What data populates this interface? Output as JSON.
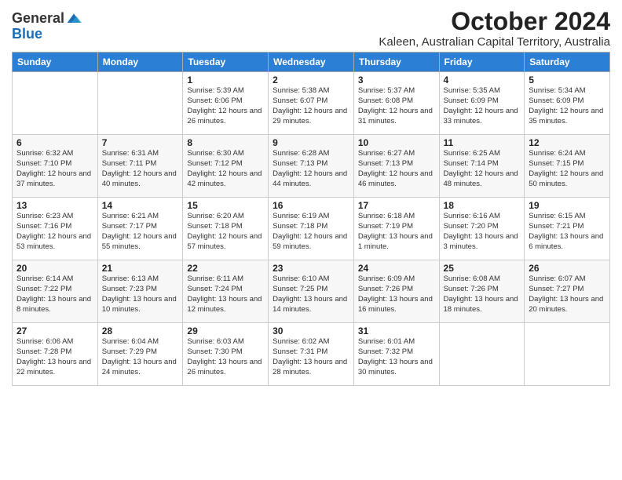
{
  "logo": {
    "general": "General",
    "blue": "Blue"
  },
  "title": "October 2024",
  "subtitle": "Kaleen, Australian Capital Territory, Australia",
  "days_of_week": [
    "Sunday",
    "Monday",
    "Tuesday",
    "Wednesday",
    "Thursday",
    "Friday",
    "Saturday"
  ],
  "weeks": [
    [
      {
        "day": "",
        "detail": ""
      },
      {
        "day": "",
        "detail": ""
      },
      {
        "day": "1",
        "detail": "Sunrise: 5:39 AM\nSunset: 6:06 PM\nDaylight: 12 hours\nand 26 minutes."
      },
      {
        "day": "2",
        "detail": "Sunrise: 5:38 AM\nSunset: 6:07 PM\nDaylight: 12 hours\nand 29 minutes."
      },
      {
        "day": "3",
        "detail": "Sunrise: 5:37 AM\nSunset: 6:08 PM\nDaylight: 12 hours\nand 31 minutes."
      },
      {
        "day": "4",
        "detail": "Sunrise: 5:35 AM\nSunset: 6:09 PM\nDaylight: 12 hours\nand 33 minutes."
      },
      {
        "day": "5",
        "detail": "Sunrise: 5:34 AM\nSunset: 6:09 PM\nDaylight: 12 hours\nand 35 minutes."
      }
    ],
    [
      {
        "day": "6",
        "detail": "Sunrise: 6:32 AM\nSunset: 7:10 PM\nDaylight: 12 hours\nand 37 minutes."
      },
      {
        "day": "7",
        "detail": "Sunrise: 6:31 AM\nSunset: 7:11 PM\nDaylight: 12 hours\nand 40 minutes."
      },
      {
        "day": "8",
        "detail": "Sunrise: 6:30 AM\nSunset: 7:12 PM\nDaylight: 12 hours\nand 42 minutes."
      },
      {
        "day": "9",
        "detail": "Sunrise: 6:28 AM\nSunset: 7:13 PM\nDaylight: 12 hours\nand 44 minutes."
      },
      {
        "day": "10",
        "detail": "Sunrise: 6:27 AM\nSunset: 7:13 PM\nDaylight: 12 hours\nand 46 minutes."
      },
      {
        "day": "11",
        "detail": "Sunrise: 6:25 AM\nSunset: 7:14 PM\nDaylight: 12 hours\nand 48 minutes."
      },
      {
        "day": "12",
        "detail": "Sunrise: 6:24 AM\nSunset: 7:15 PM\nDaylight: 12 hours\nand 50 minutes."
      }
    ],
    [
      {
        "day": "13",
        "detail": "Sunrise: 6:23 AM\nSunset: 7:16 PM\nDaylight: 12 hours\nand 53 minutes."
      },
      {
        "day": "14",
        "detail": "Sunrise: 6:21 AM\nSunset: 7:17 PM\nDaylight: 12 hours\nand 55 minutes."
      },
      {
        "day": "15",
        "detail": "Sunrise: 6:20 AM\nSunset: 7:18 PM\nDaylight: 12 hours\nand 57 minutes."
      },
      {
        "day": "16",
        "detail": "Sunrise: 6:19 AM\nSunset: 7:18 PM\nDaylight: 12 hours\nand 59 minutes."
      },
      {
        "day": "17",
        "detail": "Sunrise: 6:18 AM\nSunset: 7:19 PM\nDaylight: 13 hours\nand 1 minute."
      },
      {
        "day": "18",
        "detail": "Sunrise: 6:16 AM\nSunset: 7:20 PM\nDaylight: 13 hours\nand 3 minutes."
      },
      {
        "day": "19",
        "detail": "Sunrise: 6:15 AM\nSunset: 7:21 PM\nDaylight: 13 hours\nand 6 minutes."
      }
    ],
    [
      {
        "day": "20",
        "detail": "Sunrise: 6:14 AM\nSunset: 7:22 PM\nDaylight: 13 hours\nand 8 minutes."
      },
      {
        "day": "21",
        "detail": "Sunrise: 6:13 AM\nSunset: 7:23 PM\nDaylight: 13 hours\nand 10 minutes."
      },
      {
        "day": "22",
        "detail": "Sunrise: 6:11 AM\nSunset: 7:24 PM\nDaylight: 13 hours\nand 12 minutes."
      },
      {
        "day": "23",
        "detail": "Sunrise: 6:10 AM\nSunset: 7:25 PM\nDaylight: 13 hours\nand 14 minutes."
      },
      {
        "day": "24",
        "detail": "Sunrise: 6:09 AM\nSunset: 7:26 PM\nDaylight: 13 hours\nand 16 minutes."
      },
      {
        "day": "25",
        "detail": "Sunrise: 6:08 AM\nSunset: 7:26 PM\nDaylight: 13 hours\nand 18 minutes."
      },
      {
        "day": "26",
        "detail": "Sunrise: 6:07 AM\nSunset: 7:27 PM\nDaylight: 13 hours\nand 20 minutes."
      }
    ],
    [
      {
        "day": "27",
        "detail": "Sunrise: 6:06 AM\nSunset: 7:28 PM\nDaylight: 13 hours\nand 22 minutes."
      },
      {
        "day": "28",
        "detail": "Sunrise: 6:04 AM\nSunset: 7:29 PM\nDaylight: 13 hours\nand 24 minutes."
      },
      {
        "day": "29",
        "detail": "Sunrise: 6:03 AM\nSunset: 7:30 PM\nDaylight: 13 hours\nand 26 minutes."
      },
      {
        "day": "30",
        "detail": "Sunrise: 6:02 AM\nSunset: 7:31 PM\nDaylight: 13 hours\nand 28 minutes."
      },
      {
        "day": "31",
        "detail": "Sunrise: 6:01 AM\nSunset: 7:32 PM\nDaylight: 13 hours\nand 30 minutes."
      },
      {
        "day": "",
        "detail": ""
      },
      {
        "day": "",
        "detail": ""
      }
    ]
  ]
}
